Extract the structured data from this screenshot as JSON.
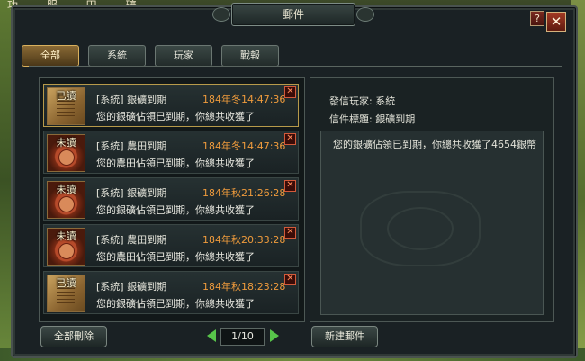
{
  "background": {
    "top_text": "功 服 田 礦"
  },
  "window": {
    "title": "郵件",
    "help_label": "?",
    "close_label": "✕"
  },
  "tabs": [
    {
      "label": "全部",
      "active": true
    },
    {
      "label": "系統",
      "active": false
    },
    {
      "label": "玩家",
      "active": false
    },
    {
      "label": "戰報",
      "active": false
    }
  ],
  "mails": [
    {
      "status": "已讀",
      "subject": "[系統] 銀礦到期",
      "time": "184年冬14:47:36",
      "body": "您的銀礦佔領已到期，你總共收獲了",
      "selected": true
    },
    {
      "status": "未讀",
      "subject": "[系統] 農田到期",
      "time": "184年冬14:47:36",
      "body": "您的農田佔領已到期，你總共收獲了",
      "selected": false
    },
    {
      "status": "未讀",
      "subject": "[系統] 銀礦到期",
      "time": "184年秋21:26:28",
      "body": "您的銀礦佔領已到期，你總共收獲了",
      "selected": false
    },
    {
      "status": "未讀",
      "subject": "[系統] 農田到期",
      "time": "184年秋20:33:28",
      "body": "您的農田佔領已到期，你總共收獲了",
      "selected": false
    },
    {
      "status": "已讀",
      "subject": "[系統] 銀礦到期",
      "time": "184年秋18:23:28",
      "body": "您的銀礦佔領已到期，你總共收獲了",
      "selected": false
    }
  ],
  "delete_icon_label": "✕",
  "detail": {
    "sender": "發信玩家: 系統",
    "subject": "信件標題: 銀礦到期",
    "content": "您的銀礦佔領已到期，你總共收獲了4654銀幣"
  },
  "footer": {
    "delete_all_label": "全部刪除",
    "page_indicator": "1/10",
    "new_mail_label": "新建郵件"
  }
}
